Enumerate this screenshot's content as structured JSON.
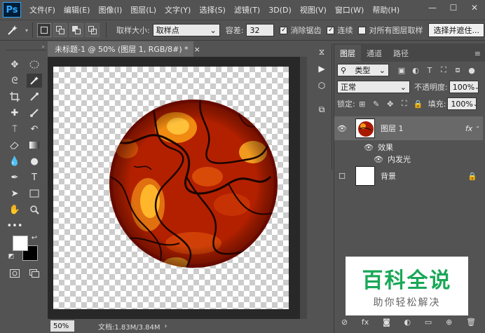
{
  "app": {
    "logo": "Ps"
  },
  "menu": [
    "文件(F)",
    "编辑(E)",
    "图像(I)",
    "图层(L)",
    "文字(Y)",
    "选择(S)",
    "滤镜(T)",
    "3D(D)",
    "视图(V)",
    "窗口(W)",
    "帮助(H)"
  ],
  "window_buttons": {
    "minimize": "—",
    "maximize": "☐",
    "close": "✕"
  },
  "options": {
    "tool_icon": "magic-wand-icon",
    "sample_size_label": "取样大小:",
    "sample_size_value": "取样点",
    "tolerance_label": "容差:",
    "tolerance_value": "32",
    "antialias_label": "消除锯齿",
    "antialias_checked": true,
    "contiguous_label": "连续",
    "contiguous_checked": true,
    "sample_all_label": "对所有图层取样",
    "sample_all_checked": false,
    "select_mask_label": "选择并遮住..."
  },
  "document": {
    "tab_title": "未标题-1 @ 50% (图层 1, RGB/8#) *",
    "tab_close": "×",
    "zoom": "50%",
    "doc_info": "文档:1.83M/3.84M"
  },
  "layers_panel": {
    "tabs": [
      "图层",
      "通道",
      "路径"
    ],
    "filter_label": "类型",
    "blend_mode": "正常",
    "opacity_label": "不透明度:",
    "opacity_value": "100%",
    "lock_label": "锁定:",
    "fill_label": "填充:",
    "fill_value": "100%",
    "layers": [
      {
        "name": "图层 1",
        "fx": "fx",
        "selected": true
      },
      {
        "name": "背景",
        "locked": true
      }
    ],
    "effects_label": "效果",
    "effect_name": "内发光"
  },
  "watermark": {
    "title": "百科全说",
    "subtitle": "助你轻松解决"
  },
  "colors": {
    "ui_dark": "#535353",
    "lava_dark": "#8a1000",
    "lava_bright": "#ffb020",
    "accent_green": "#19a857"
  }
}
